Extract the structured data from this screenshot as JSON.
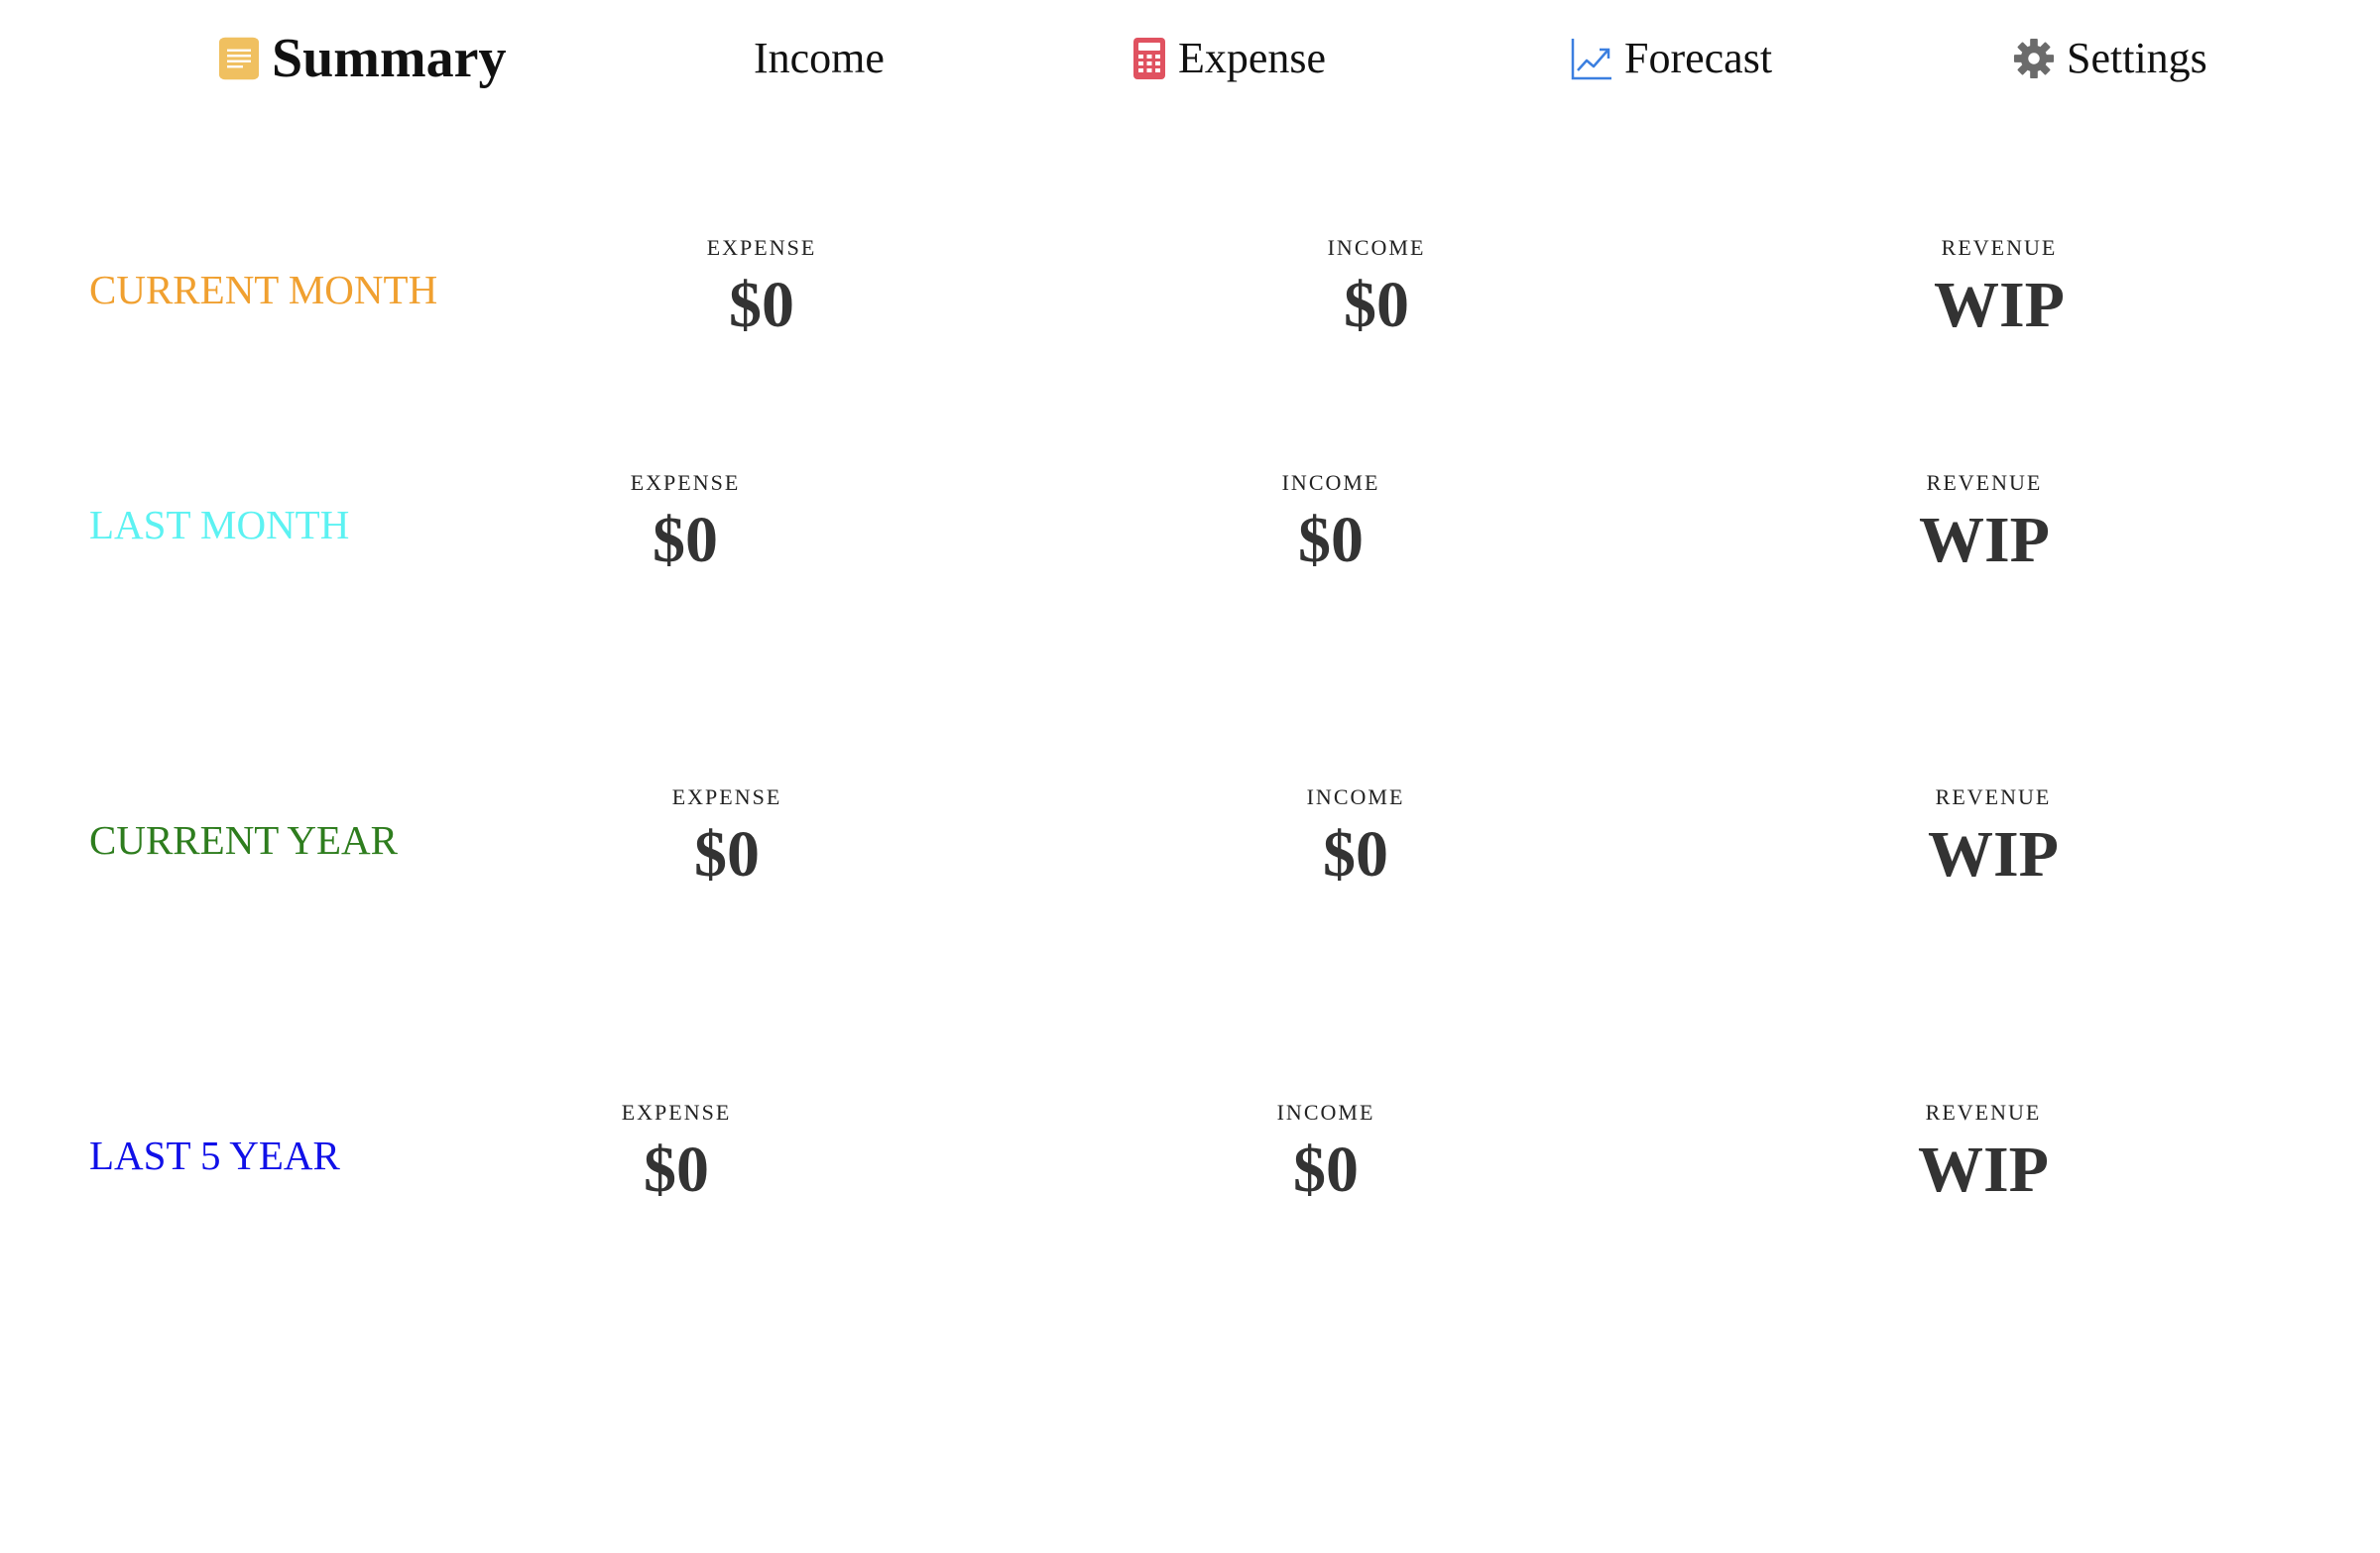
{
  "nav": {
    "summary": {
      "label": "Summary",
      "icon": "document-icon",
      "color": "#f0c060"
    },
    "income": {
      "label": "Income"
    },
    "expense": {
      "label": "Expense",
      "icon": "calculator-icon",
      "color": "#e05260"
    },
    "forecast": {
      "label": "Forecast",
      "icon": "line-chart-icon",
      "color": "#3b7fe0"
    },
    "settings": {
      "label": "Settings",
      "icon": "gear-icon",
      "color": "#6b6b6b"
    }
  },
  "periods": [
    {
      "label": "CURRENT MONTH",
      "color": "#f0a030",
      "expense": {
        "caption": "EXPENSE",
        "value": "$0"
      },
      "income": {
        "caption": "INCOME",
        "value": "$0"
      },
      "revenue": {
        "caption": "REVENUE",
        "value": "WIP"
      }
    },
    {
      "label": "LAST MONTH",
      "color": "#5cf2f2",
      "expense": {
        "caption": "EXPENSE",
        "value": "$0"
      },
      "income": {
        "caption": "INCOME",
        "value": "$0"
      },
      "revenue": {
        "caption": "REVENUE",
        "value": "WIP"
      }
    },
    {
      "label": "CURRENT YEAR",
      "color": "#2e7d1e",
      "expense": {
        "caption": "EXPENSE",
        "value": "$0"
      },
      "income": {
        "caption": "INCOME",
        "value": "$0"
      },
      "revenue": {
        "caption": "REVENUE",
        "value": "WIP"
      }
    },
    {
      "label": "LAST 5 YEAR",
      "color": "#1010e8",
      "expense": {
        "caption": "EXPENSE",
        "value": "$0"
      },
      "income": {
        "caption": "INCOME",
        "value": "$0"
      },
      "revenue": {
        "caption": "REVENUE",
        "value": "WIP"
      }
    }
  ]
}
